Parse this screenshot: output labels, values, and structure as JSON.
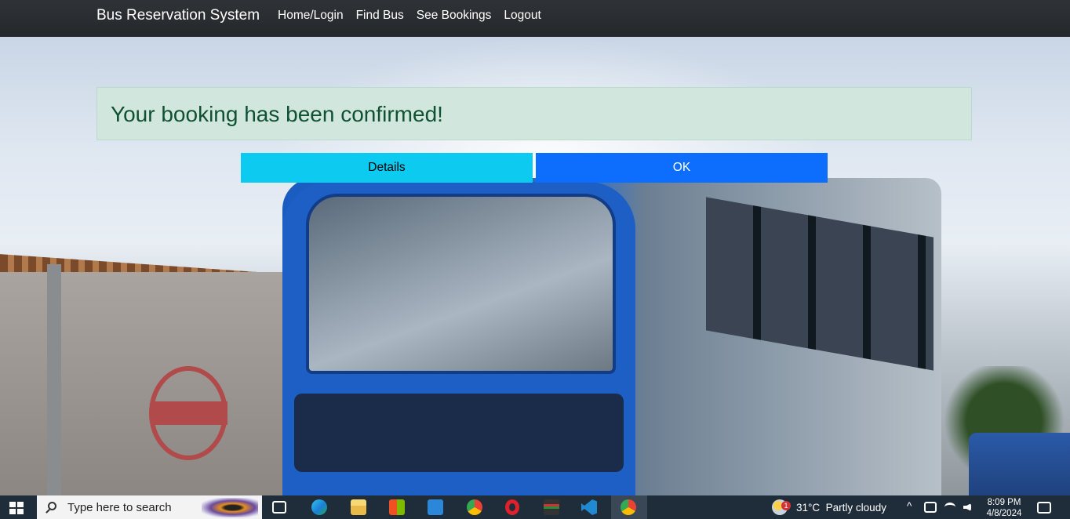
{
  "navbar": {
    "brand": "Bus Reservation System",
    "links": [
      "Home/Login",
      "Find Bus",
      "See Bookings",
      "Logout"
    ]
  },
  "alert": {
    "message": "Your booking has been confirmed!"
  },
  "buttons": {
    "details": "Details",
    "ok": "OK"
  },
  "taskbar": {
    "search_placeholder": "Type here to search",
    "weather": "31°C  Partly cloudy",
    "weather_badge": "1",
    "time": "8:09 PM",
    "date": "4/8/2024",
    "icons": [
      "start-icon",
      "task-view-icon",
      "edge-icon",
      "file-explorer-icon",
      "store-icon",
      "mail-icon",
      "chrome-icon",
      "opera-icon",
      "film-icon",
      "vscode-icon",
      "chrome-icon"
    ]
  },
  "colors": {
    "navbar": "#2f3236",
    "alert_bg": "#d1e7dd",
    "alert_text": "#0f5132",
    "details_btn": "#0dcaf0",
    "ok_btn": "#0d6efd",
    "taskbar": "#1f2c3a"
  }
}
